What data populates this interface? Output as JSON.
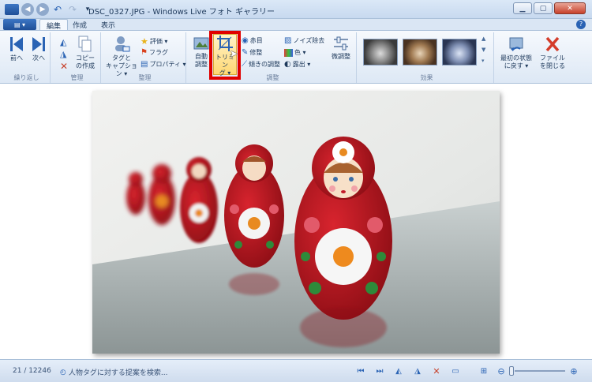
{
  "window": {
    "title": "DSC_0327.JPG - Windows Live フォト ギャラリー"
  },
  "tabs": [
    {
      "label": "編集"
    },
    {
      "label": "作成"
    },
    {
      "label": "表示"
    }
  ],
  "ribbon": {
    "groups": {
      "navigate": {
        "label": "繰り返し",
        "prev": "前へ",
        "next": "次へ"
      },
      "manage": {
        "label": "管理",
        "copy_line1": "コピー",
        "copy_line2": "の作成"
      },
      "organize": {
        "label": "整理",
        "tag_line1": "タグと",
        "tag_line2": "キャプション ▾",
        "rate": "評価 ▾",
        "flag": "フラグ",
        "properties": "プロパティ ▾"
      },
      "adjust": {
        "label": "調整",
        "auto_line1": "自動",
        "auto_line2": "調整",
        "crop_line1": "トリミン",
        "crop_line2": "グ ▾",
        "redeye": "赤目",
        "retouch": "修整",
        "straighten": "傾きの調整",
        "noise": "ノイズ除去",
        "color": "色 ▾",
        "exposure": "露出 ▾",
        "fine_tune": "微調整"
      },
      "effects": {
        "label": "効果"
      },
      "revert": {
        "line1": "最初の状態",
        "line2": "に戻す ▾"
      },
      "close": {
        "line1": "ファイル",
        "line2": "を閉じる"
      }
    }
  },
  "status": {
    "counter": "21 / 12246",
    "tag_suggest": "人物タグに対する提案を検索..."
  },
  "colors": {
    "accent": "#2a63b4",
    "highlight": "#e00000",
    "doll_red": "#b3151f"
  }
}
